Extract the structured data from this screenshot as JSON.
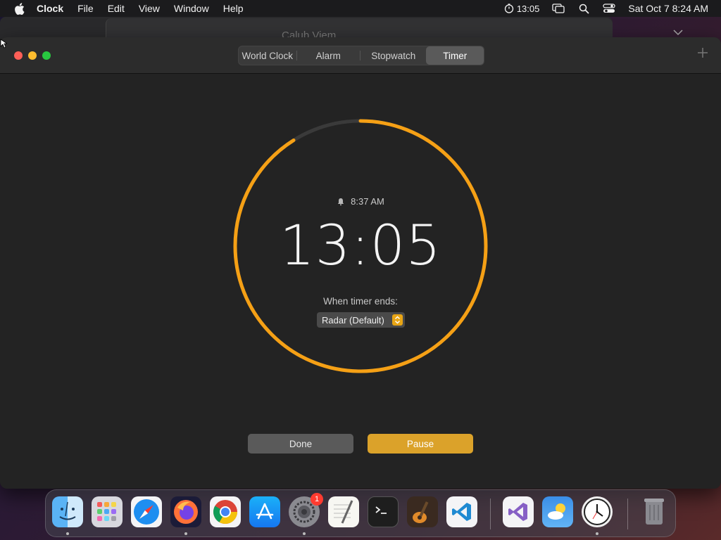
{
  "menubar": {
    "app_name": "Clock",
    "menus": [
      "File",
      "Edit",
      "View",
      "Window",
      "Help"
    ],
    "timer_status": "13:05",
    "datetime": "Sat Oct 7  8:24 AM"
  },
  "background_window": {
    "title": "Calub Viem"
  },
  "tabs": [
    {
      "label": "World Clock",
      "active": false
    },
    {
      "label": "Alarm",
      "active": false
    },
    {
      "label": "Stopwatch",
      "active": false
    },
    {
      "label": "Timer",
      "active": true
    }
  ],
  "timer": {
    "alarm_time": "8:37 AM",
    "remaining": "13:05",
    "progress_remaining_fraction": 0.91,
    "ends_label": "When timer ends:",
    "sound_selected": "Radar (Default)",
    "done_label": "Done",
    "pause_label": "Pause"
  },
  "colors": {
    "accent": "#f5a015",
    "track": "#3a3a3a"
  },
  "dock": {
    "items": [
      {
        "name": "Finder",
        "icon": "finder-icon",
        "running": true
      },
      {
        "name": "Launchpad",
        "icon": "launchpad-icon",
        "running": false
      },
      {
        "name": "Safari",
        "icon": "safari-icon",
        "running": false
      },
      {
        "name": "Firefox",
        "icon": "firefox-icon",
        "running": true
      },
      {
        "name": "Chrome",
        "icon": "chrome-icon",
        "running": false
      },
      {
        "name": "App Store",
        "icon": "app-store-icon",
        "running": false
      },
      {
        "name": "System Settings",
        "icon": "system-settings-icon",
        "running": true,
        "badge": "1"
      },
      {
        "name": "TextEdit",
        "icon": "textedit-icon",
        "running": false
      },
      {
        "name": "Terminal",
        "icon": "terminal-icon",
        "running": false
      },
      {
        "name": "GarageBand",
        "icon": "garageband-icon",
        "running": false
      },
      {
        "name": "VS Code",
        "icon": "vscode-icon",
        "running": false
      },
      {
        "name": "Visual Studio",
        "icon": "visual-studio-icon",
        "running": false
      },
      {
        "name": "Weather",
        "icon": "weather-icon",
        "running": false
      },
      {
        "name": "Clock",
        "icon": "clock-icon",
        "running": true
      },
      {
        "name": "Trash",
        "icon": "trash-icon",
        "running": false
      }
    ]
  }
}
